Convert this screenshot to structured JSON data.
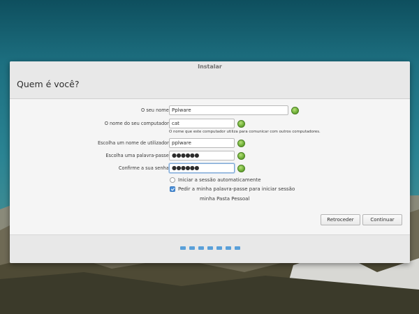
{
  "window": {
    "title": "Instalar",
    "page_title": "Quem é você?"
  },
  "form": {
    "name_label": "O seu nome:",
    "name_value": "Pplware",
    "computer_label": "O nome do seu computador:",
    "computer_value": "cat",
    "computer_hint": "O nome que este computador utiliza para comunicar com outros computadores.",
    "username_label": "Escolha um nome de utilizador:",
    "username_value": "pplware",
    "password_label": "Escolha uma palavra-passe:",
    "password_value": "●●●●●●",
    "confirm_label": "Confirme a sua senha:",
    "confirm_value": "●●●●●●",
    "auto_login_label": "Iniciar a sessão automaticamente",
    "require_password_label": "Pedir a minha palavra-passe para iniciar sessão",
    "encrypt_label": "minha Pasta Pessoal"
  },
  "buttons": {
    "back": "Retroceder",
    "continue": "Continuar"
  },
  "progress": {
    "steps_total": 7
  },
  "colors": {
    "accent": "#4a8fd8",
    "ok": "#72b23a",
    "progress_dot": "#5aa0d9"
  }
}
